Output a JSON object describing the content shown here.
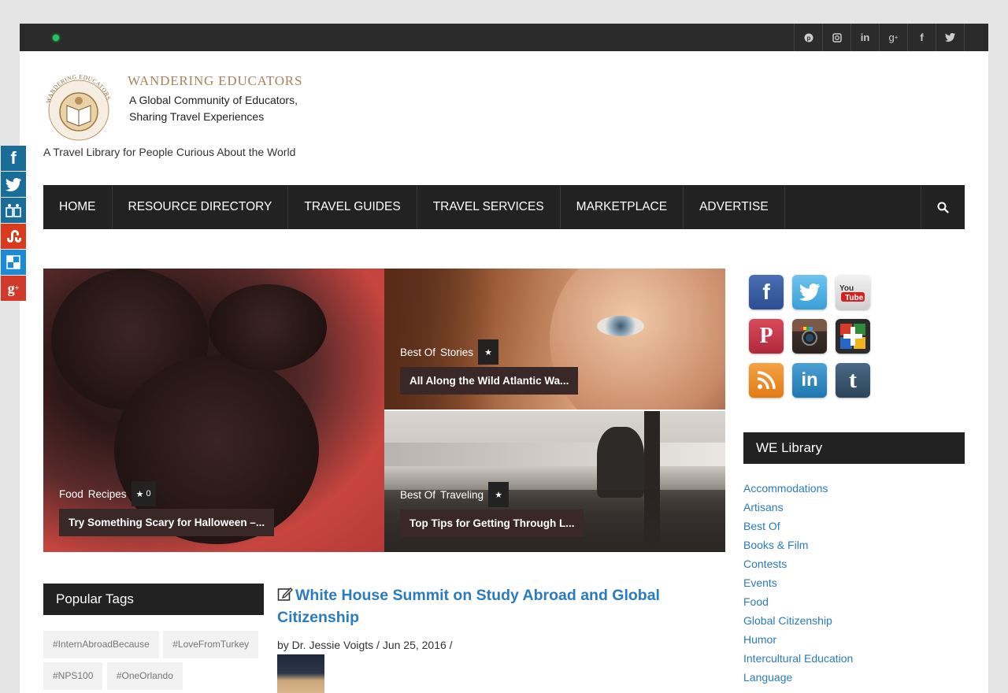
{
  "site": {
    "logo_title": "WANDERING EDUCATORS",
    "logo_line1": "A Global Community of Educators,",
    "logo_line2": "Sharing Travel Experiences",
    "logo_ring_text": "WANDERING EDUCATORS",
    "tagline": "A Travel Library for People Curious About the World"
  },
  "topbar": {
    "social_icons": [
      "pinterest-icon",
      "instagram-icon",
      "linkedin-icon",
      "google-plus-icon",
      "facebook-icon",
      "twitter-icon"
    ]
  },
  "nav": {
    "items": [
      "HOME",
      "RESOURCE DIRECTORY",
      "TRAVEL GUIDES",
      "TRAVEL SERVICES",
      "MARKETPLACE",
      "ADVERTISE"
    ]
  },
  "slides": [
    {
      "cat1": "Food",
      "cat2": "Recipes",
      "count": "0",
      "title": "Try Something Scary for Halloween –..."
    },
    {
      "cat1": "Best Of",
      "cat2": "Stories",
      "count": "",
      "title": "All Along the Wild Atlantic Wa..."
    },
    {
      "cat1": "Best Of",
      "cat2": "Traveling",
      "count": "",
      "title": "Top Tips for Getting Through L..."
    }
  ],
  "sidebar": {
    "social_icons": [
      "facebook-icon",
      "twitter-icon",
      "youtube-icon",
      "pinterest-icon",
      "instagram-icon",
      "google-plus-icon",
      "rss-icon",
      "linkedin-icon",
      "tumblr-icon"
    ],
    "library_title": "WE Library",
    "library_items": [
      "Accommodations",
      "Artisans",
      "Best Of",
      "Books & Film",
      "Contests",
      "Events",
      "Food",
      "Global Citizenship",
      "Humor",
      "Intercultural Education",
      "Language"
    ]
  },
  "tags": {
    "title": "Popular Tags",
    "items": [
      "#InternAbroadBecause",
      "#LoveFromTurkey",
      "#NPS100",
      "#OneOrlando"
    ]
  },
  "post": {
    "title": "White House Summit on Study Abroad and Global Citizenship",
    "meta": "by Dr. Jessie Voigts / Jun 25, 2016 /"
  },
  "floating_share": [
    "facebook-icon",
    "twitter-icon",
    "myspace-icon",
    "stumbleupon-icon",
    "delicious-icon",
    "google-plus-icon"
  ],
  "colors": {
    "link": "#2a7bc0",
    "nav_bg": "#222222",
    "topbar_bg": "#2b2b2b",
    "status_dot": "#27c26b"
  }
}
